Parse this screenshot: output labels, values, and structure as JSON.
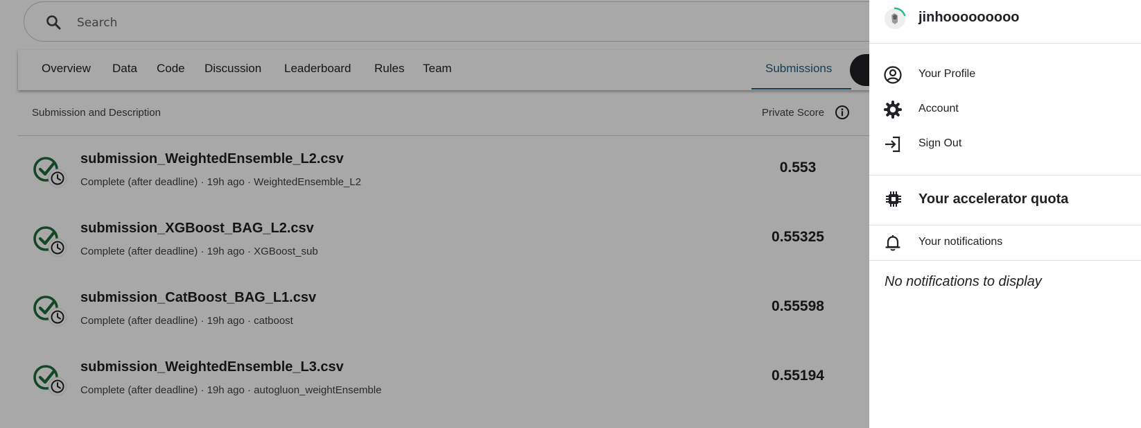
{
  "search": {
    "placeholder": "Search"
  },
  "tabs": [
    {
      "label": "Overview"
    },
    {
      "label": "Data"
    },
    {
      "label": "Code"
    },
    {
      "label": "Discussion"
    },
    {
      "label": "Leaderboard"
    },
    {
      "label": "Rules"
    },
    {
      "label": "Team"
    },
    {
      "label": "Submissions"
    }
  ],
  "active_tab": "Submissions",
  "table": {
    "header_left": "Submission and Description",
    "header_right": "Private Score",
    "rows": [
      {
        "title": "submission_WeightedEnsemble_L2.csv",
        "desc": "Complete (after deadline) · 19h ago · WeightedEnsemble_L2",
        "score": "0.553"
      },
      {
        "title": "submission_XGBoost_BAG_L2.csv",
        "desc": "Complete (after deadline) · 19h ago · XGBoost_sub",
        "score": "0.55325"
      },
      {
        "title": "submission_CatBoost_BAG_L1.csv",
        "desc": "Complete (after deadline) · 19h ago · catboost",
        "score": "0.55598"
      },
      {
        "title": "submission_WeightedEnsemble_L3.csv",
        "desc": "Complete (after deadline) · 19h ago · autogluon_weightEnsemble",
        "score": "0.55194"
      }
    ]
  },
  "panel": {
    "username": "jinhooooooooo",
    "menu": [
      {
        "label": "Your Profile",
        "icon": "profile-icon"
      },
      {
        "label": "Account",
        "icon": "gear-icon"
      },
      {
        "label": "Sign Out",
        "icon": "sign-out-icon"
      }
    ],
    "quota_label": "Your accelerator quota",
    "notifications_label": "Your notifications",
    "no_notifications": "No notifications to display"
  },
  "colors": {
    "accent": "#20607e",
    "status_green": "#1e6e3c",
    "overlay": "rgba(0,0,0,0.34)"
  }
}
